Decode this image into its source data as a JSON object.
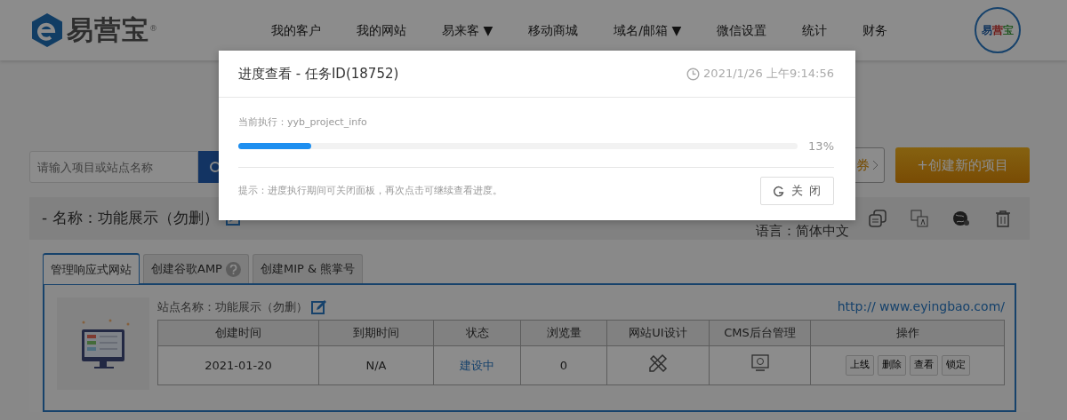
{
  "header": {
    "logo_text": "易营宝",
    "logo_mark": "®",
    "nav": [
      {
        "label": "我的客户"
      },
      {
        "label": "我的网站"
      },
      {
        "label": "易来客",
        "caret": "▼"
      },
      {
        "label": "移动商城"
      },
      {
        "label": "域名/邮箱",
        "caret": "▼"
      },
      {
        "label": "微信设置"
      },
      {
        "label": "统计"
      },
      {
        "label": "财务"
      }
    ],
    "avatar_text": "易营宝"
  },
  "toolbar": {
    "search": {
      "placeholder": "请输入项目或站点名称"
    },
    "coupon_button": "券",
    "create_button": "+创建新的项目"
  },
  "project": {
    "title": "- 名称：功能展示（勿删）",
    "language": "语言：简体中文",
    "tabs": [
      {
        "label": "管理响应式网站",
        "selected": true,
        "help": false
      },
      {
        "label": "创建谷歌AMP",
        "selected": false,
        "help": true
      },
      {
        "label": "创建MIP & 熊掌号",
        "selected": false,
        "help": false
      }
    ],
    "site_name": "站点名称：功能展示（勿删）",
    "url": "http:// www.eyingbao.com/",
    "table": {
      "columns": [
        "创建时间",
        "到期时间",
        "状态",
        "浏览量",
        "网站UI设计",
        "CMS后台管理",
        "操作"
      ],
      "row": [
        {
          "kind": "text",
          "text": "2021-01-20"
        },
        {
          "kind": "text",
          "text": "N/A"
        },
        {
          "kind": "link",
          "text": "建设中"
        },
        {
          "kind": "text",
          "text": "0"
        },
        {
          "kind": "design"
        },
        {
          "kind": "cms"
        },
        {
          "kind": "actions",
          "buttons": [
            "上线",
            "删除",
            "查看",
            "锁定"
          ]
        }
      ]
    }
  },
  "dialog": {
    "title": "进度查看 - 任务ID(18752)",
    "time": "2021/1/26 上午9:14:56",
    "current": "当前执行：yyb_project_info",
    "progress": {
      "level": 0.13,
      "reading": "13%"
    },
    "hint": "提示：进度执行期间可关闭面板，再次点击可继续查看进度。",
    "close_button": "关 闭"
  }
}
